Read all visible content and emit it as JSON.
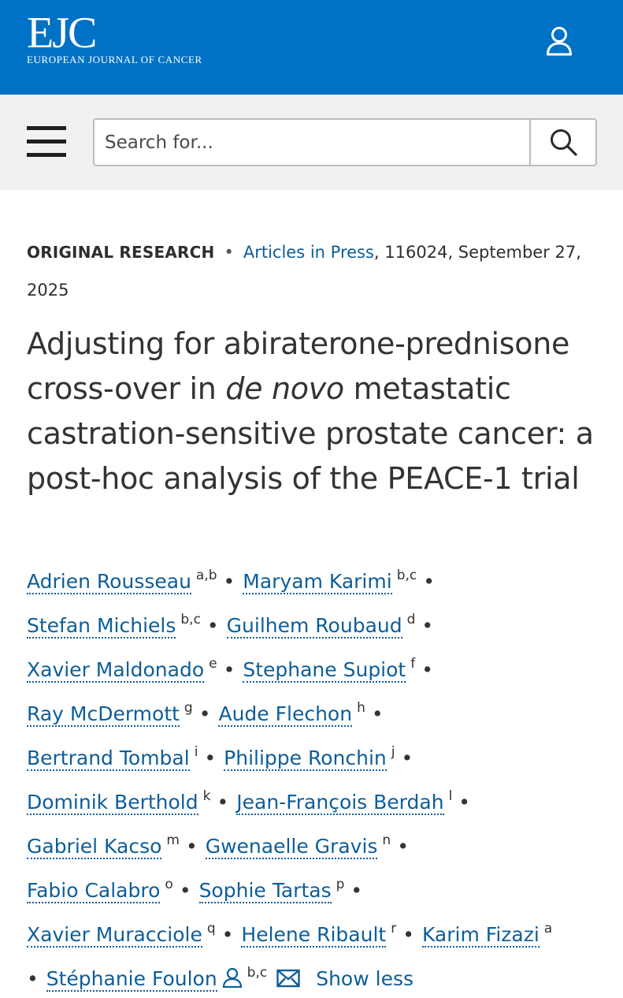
{
  "header": {
    "logo_mark": "EJC",
    "logo_text": "EUROPEAN JOURNAL OF CANCER",
    "brand_color": "#0072c6",
    "user_icon": "user-icon"
  },
  "search": {
    "placeholder": "Search for...",
    "menu_icon": "hamburger-menu-icon",
    "search_icon": "search-icon"
  },
  "article": {
    "type": "ORIGINAL RESEARCH",
    "section_link": "Articles in Press",
    "citation_rest": ", 116024, September 27, 2025",
    "title_part1": "Adjusting for abiraterone-prednisone cross-over in ",
    "title_italic": "de novo",
    "title_part2": " metastatic castration-sensitive prostate cancer: a post-hoc analysis of the PEACE-1 trial"
  },
  "authors": [
    {
      "name": "Adrien Rousseau",
      "aff": "a,b"
    },
    {
      "name": "Maryam Karimi",
      "aff": "b,c"
    },
    {
      "name": "Stefan Michiels",
      "aff": "b,c"
    },
    {
      "name": "Guilhem Roubaud",
      "aff": "d"
    },
    {
      "name": "Xavier Maldonado",
      "aff": "e"
    },
    {
      "name": "Stephane Supiot",
      "aff": "f"
    },
    {
      "name": "Ray McDermott",
      "aff": "g"
    },
    {
      "name": "Aude Flechon",
      "aff": "h"
    },
    {
      "name": "Bertrand Tombal",
      "aff": "i"
    },
    {
      "name": "Philippe Ronchin",
      "aff": "j"
    },
    {
      "name": "Dominik Berthold",
      "aff": "k"
    },
    {
      "name": "Jean-François Berdah",
      "aff": "l"
    },
    {
      "name": "Gabriel Kacso",
      "aff": "m"
    },
    {
      "name": "Gwenaelle Gravis",
      "aff": "n"
    },
    {
      "name": "Fabio Calabro",
      "aff": "o"
    },
    {
      "name": "Sophie Tartas",
      "aff": "p"
    },
    {
      "name": "Xavier Muracciole",
      "aff": "q"
    },
    {
      "name": "Helene Ribault",
      "aff": "r"
    },
    {
      "name": "Karim Fizazi",
      "aff": "a"
    },
    {
      "name": "Stéphanie Foulon",
      "aff": "b,c",
      "icons": [
        "person-icon",
        "email-icon"
      ]
    }
  ],
  "separator": "•",
  "show_less_label": "Show less"
}
